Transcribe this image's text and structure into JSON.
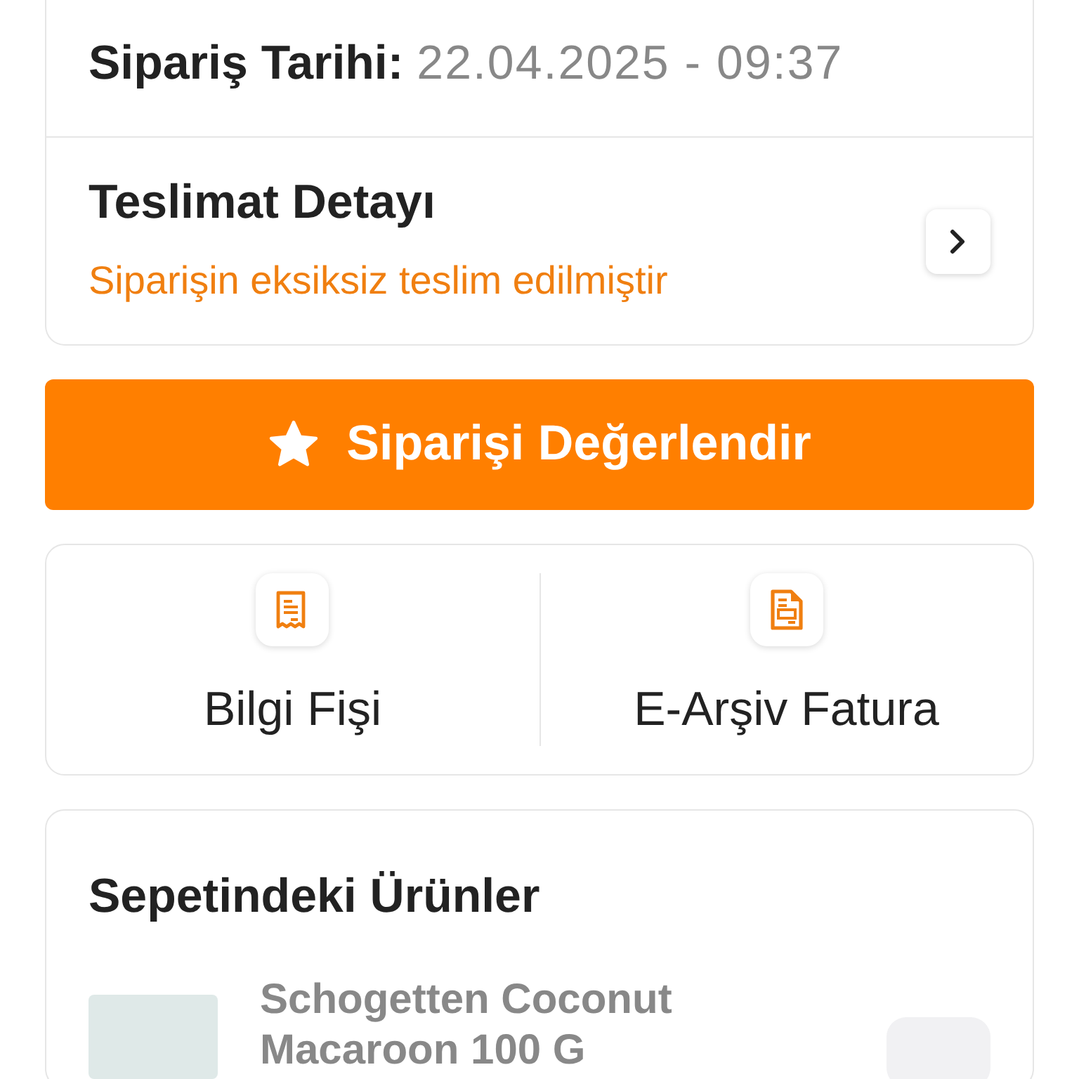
{
  "order_info": {
    "date_label": "Sipariş Tarihi:",
    "date_value": "22.04.2025 - 09:37"
  },
  "delivery": {
    "title": "Teslimat Detayı",
    "status": "Siparişin eksiksiz teslim edilmiştir"
  },
  "rate_button": {
    "label": "Siparişi Değerlendir"
  },
  "documents": [
    {
      "kind": "receipt",
      "label": "Bilgi Fişi"
    },
    {
      "kind": "invoice",
      "label": "E-Arşiv Fatura"
    }
  ],
  "basket": {
    "title": "Sepetindeki Ürünler",
    "products": [
      {
        "name": "Schogetten Coconut Macaroon 100 G"
      }
    ]
  }
}
